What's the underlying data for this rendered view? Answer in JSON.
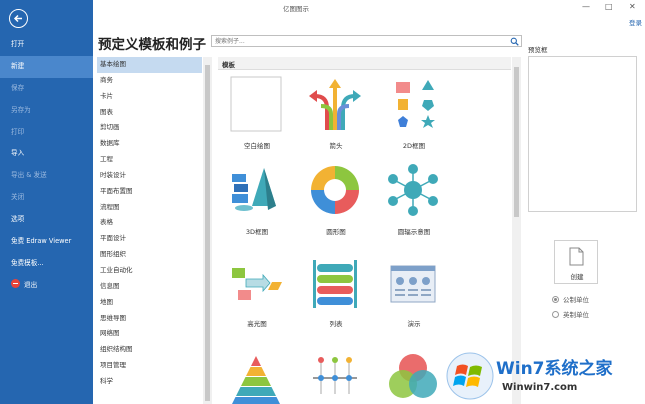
{
  "window": {
    "title": "亿图图示",
    "minimize": "—",
    "maximize": "□",
    "close": "✕",
    "login": "登录"
  },
  "sidebar": {
    "items": [
      {
        "label": "打开",
        "dim": false,
        "active": false
      },
      {
        "label": "新建",
        "dim": false,
        "active": true
      },
      {
        "label": "保存",
        "dim": true,
        "active": false
      },
      {
        "label": "另存为",
        "dim": true,
        "active": false
      },
      {
        "label": "打印",
        "dim": true,
        "active": false
      },
      {
        "label": "导入",
        "dim": false,
        "active": false
      },
      {
        "label": "导出 & 发送",
        "dim": true,
        "active": false
      },
      {
        "label": "关闭",
        "dim": true,
        "active": false
      },
      {
        "label": "选项",
        "dim": false,
        "active": false
      },
      {
        "label": "免费 Edraw Viewer",
        "dim": false,
        "active": false
      },
      {
        "label": "免费模板...",
        "dim": false,
        "active": false
      },
      {
        "label": "退出",
        "dim": false,
        "active": false
      }
    ]
  },
  "main": {
    "heading": "预定义模板和例子",
    "search_placeholder": "搜索例子..."
  },
  "categories": [
    "基本绘图",
    "商务",
    "卡片",
    "图表",
    "剪切画",
    "数据库",
    "工程",
    "时装设计",
    "平面布置图",
    "流程图",
    "表格",
    "平面设计",
    "图形组织",
    "工业自动化",
    "信息图",
    "地图",
    "思维导图",
    "网络图",
    "组织结构图",
    "项目管理",
    "科学"
  ],
  "gallery": {
    "header": "模板",
    "tiles": [
      {
        "label": "空白绘图"
      },
      {
        "label": "箭头"
      },
      {
        "label": "2D框图"
      },
      {
        "label": "3D框图"
      },
      {
        "label": "圆形图"
      },
      {
        "label": "圆辐示意图"
      },
      {
        "label": "高光图"
      },
      {
        "label": "列表"
      },
      {
        "label": "演示"
      },
      {
        "label": ""
      },
      {
        "label": ""
      },
      {
        "label": ""
      }
    ]
  },
  "preview": {
    "label": "预览框"
  },
  "create": {
    "label": "创建"
  },
  "units": [
    {
      "label": "公制单位",
      "checked": true
    },
    {
      "label": "英制单位",
      "checked": false
    }
  ],
  "watermark": {
    "line1": "Win7系统之家",
    "line2": "Winwin7.com"
  },
  "colors": {
    "sidebar": "#2566b0",
    "sidebar_active": "#4a87cc",
    "category_selected": "#c5daf0",
    "accent_teal": "#3fa9b8"
  }
}
